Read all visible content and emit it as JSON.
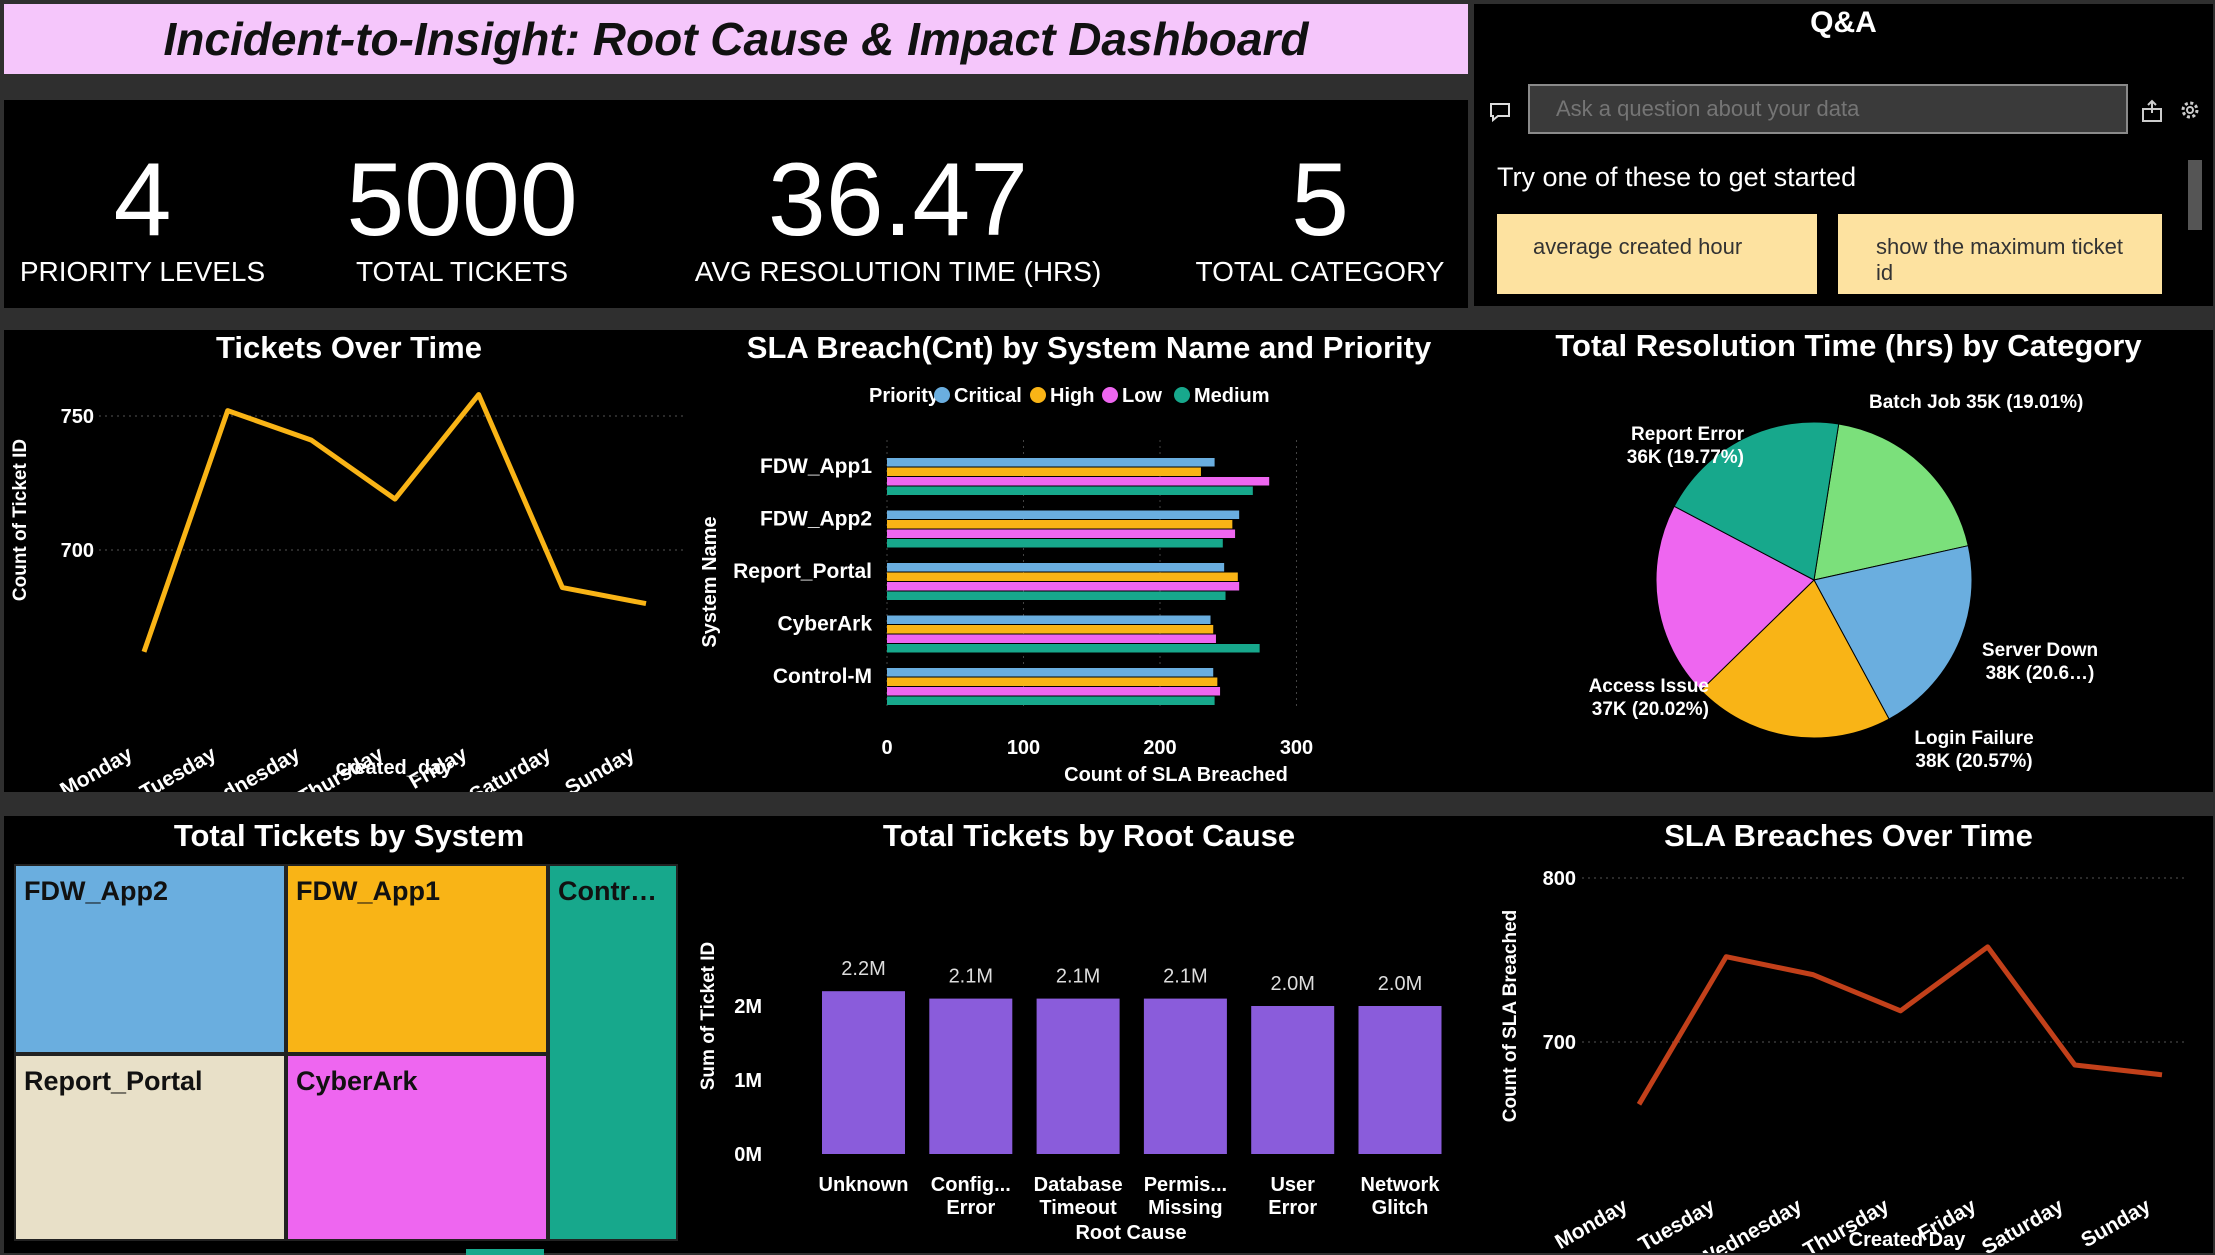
{
  "header": {
    "title": "Incident-to-Insight: Root Cause & Impact Dashboard"
  },
  "kpis": [
    {
      "value": "4",
      "label": "PRIORITY LEVELS"
    },
    {
      "value": "5000",
      "label": "TOTAL TICKETS"
    },
    {
      "value": "36.47",
      "label": "AVG RESOLUTION TIME (HRS)"
    },
    {
      "value": "5",
      "label": "TOTAL CATEGORY"
    }
  ],
  "qa": {
    "title": "Q&A",
    "placeholder": "Ask a question about your data",
    "prompt": "Try one of these to get started",
    "suggestions": [
      "average created hour",
      "show the maximum ticket id"
    ]
  },
  "chart_data": [
    {
      "type": "line",
      "title": "Tickets Over Time",
      "xlabel": "created_day",
      "ylabel": "Count of Ticket ID",
      "x": [
        "Monday",
        "Tuesday",
        "Wednesday",
        "Thursday",
        "Friday",
        "Saturday",
        "Sunday"
      ],
      "values": [
        662,
        752,
        741,
        719,
        758,
        686,
        680
      ],
      "yticks": [
        "750",
        "700"
      ],
      "color": "#f9b416"
    },
    {
      "type": "bar",
      "title": "SLA Breach(Cnt) by System Name and Priority",
      "orientation": "horizontal",
      "legend_title": "Priority",
      "xlabel": "Count of SLA Breached",
      "ylabel": "System Name",
      "categories": [
        "FDW_App1",
        "FDW_App2",
        "Report_Portal",
        "CyberArk",
        "Control-M"
      ],
      "xticks": [
        "0",
        "100",
        "200",
        "300"
      ],
      "series": [
        {
          "name": "Critical",
          "color": "#6aaedf",
          "values": [
            240,
            258,
            247,
            237,
            239
          ]
        },
        {
          "name": "High",
          "color": "#f9b416",
          "values": [
            230,
            253,
            257,
            239,
            242
          ]
        },
        {
          "name": "Low",
          "color": "#ee66f0",
          "values": [
            280,
            255,
            258,
            241,
            244
          ]
        },
        {
          "name": "Medium",
          "color": "#17a88c",
          "values": [
            268,
            246,
            248,
            273,
            240
          ]
        }
      ]
    },
    {
      "type": "pie",
      "title": "Total Resolution Time (hrs) by Category",
      "slices": [
        {
          "label": "Batch Job 35K (19.01%)",
          "value": 19.01,
          "color": "#7be07b"
        },
        {
          "label": "Server Down 38K (20.6…)",
          "value": 20.6,
          "color": "#6aaedf"
        },
        {
          "label": "Login Failure 38K (20.57%)",
          "value": 20.57,
          "color": "#f9b416"
        },
        {
          "label": "Access Issue 37K (20.02%)",
          "value": 20.02,
          "color": "#ee66f0"
        },
        {
          "label": "Report Error 36K (19.77%)",
          "value": 19.77,
          "color": "#17a88c"
        }
      ]
    },
    {
      "type": "treemap",
      "title": "Total Tickets by System",
      "items": [
        {
          "label": "FDW_App2",
          "color": "#6aaedf"
        },
        {
          "label": "FDW_App1",
          "color": "#f9b416"
        },
        {
          "label": "Contr…",
          "color": "#17a88c"
        },
        {
          "label": "Report_Portal",
          "color": "#e8e0c8"
        },
        {
          "label": "CyberArk",
          "color": "#ee66f0"
        }
      ]
    },
    {
      "type": "bar",
      "title": "Total Tickets by Root Cause",
      "xlabel": "Root Cause",
      "ylabel": "Sum of Ticket ID",
      "categories": [
        "Unknown",
        "Config... Error",
        "Database Timeout",
        "Permis... Missing",
        "User Error",
        "Network Glitch"
      ],
      "values": [
        2.2,
        2.1,
        2.1,
        2.1,
        2.0,
        2.0
      ],
      "data_labels": [
        "2.2M",
        "2.1M",
        "2.1M",
        "2.1M",
        "2.0M",
        "2.0M"
      ],
      "yticks": [
        "2M",
        "1M",
        "0M"
      ],
      "color": "#8a5cdb"
    },
    {
      "type": "line",
      "title": "SLA Breaches Over Time",
      "xlabel": "Created Day",
      "ylabel": "Count of SLA Breached",
      "x": [
        "Monday",
        "Tuesday",
        "Wednesday",
        "Thursday",
        "Friday",
        "Saturday",
        "Sunday"
      ],
      "values": [
        662,
        752,
        741,
        719,
        758,
        686,
        680
      ],
      "yticks": [
        "800",
        "700"
      ],
      "color": "#c2401a"
    }
  ]
}
